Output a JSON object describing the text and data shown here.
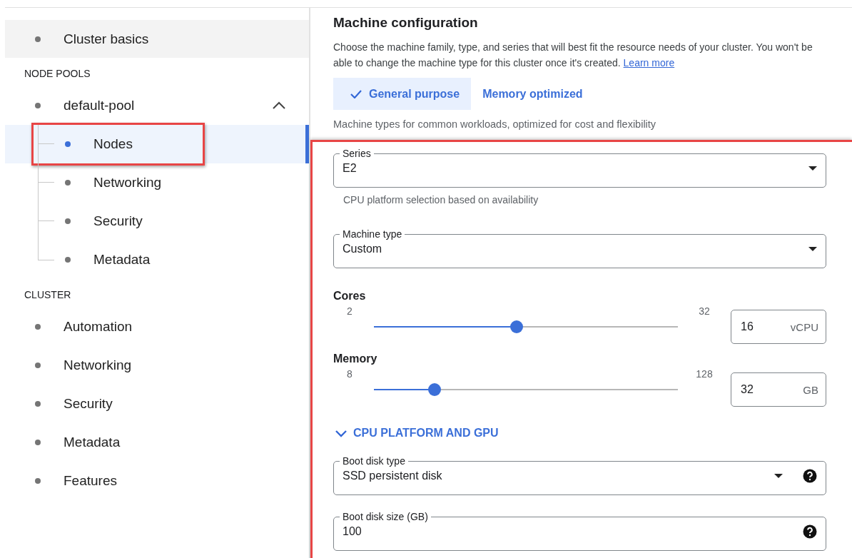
{
  "sidebar": {
    "top_item": {
      "label": "Cluster basics",
      "hovered": true,
      "selected": false
    },
    "groups": [
      {
        "heading": "NODE POOLS",
        "items": [
          {
            "label": "default-pool",
            "selected": false,
            "expanded": true,
            "children": [
              {
                "label": "Nodes",
                "selected": true,
                "annotated": true
              },
              {
                "label": "Networking",
                "selected": false,
                "annotated": false
              },
              {
                "label": "Security",
                "selected": false,
                "annotated": false
              },
              {
                "label": "Metadata",
                "selected": false,
                "annotated": false
              }
            ]
          }
        ]
      },
      {
        "heading": "CLUSTER",
        "items": [
          {
            "label": "Automation",
            "selected": false
          },
          {
            "label": "Networking",
            "selected": false
          },
          {
            "label": "Security",
            "selected": false
          },
          {
            "label": "Metadata",
            "selected": false
          },
          {
            "label": "Features",
            "selected": false
          }
        ]
      }
    ]
  },
  "main": {
    "title": "Machine configuration",
    "description": "Choose the machine family, type, and series that will best fit the resource needs of your cluster. You won't be able to change the machine type for this cluster once it's created.",
    "link": "Learn more",
    "tabs": [
      {
        "label": "General purpose",
        "selected": true
      },
      {
        "label": "Memory optimized",
        "selected": false
      }
    ],
    "tab_hint": "Machine types for common workloads, optimized for cost and flexibility",
    "panel": {
      "annotated": true,
      "fields": [
        {
          "kind": "select",
          "label": "Series",
          "value": "E2",
          "helper": "CPU platform selection based on availability",
          "help": false
        },
        {
          "kind": "select",
          "label": "Machine type",
          "value": "Custom",
          "help": false
        },
        {
          "kind": "slider",
          "label": "Cores",
          "min": "2",
          "max": "32",
          "level": 0.47,
          "value": "16",
          "unit": "vCPU"
        },
        {
          "kind": "slider",
          "label": "Memory",
          "min": "8",
          "max": "128",
          "level": 0.2,
          "value": "32",
          "unit": "GB"
        },
        {
          "kind": "expander",
          "label": "CPU PLATFORM AND GPU",
          "expanded": false
        },
        {
          "kind": "select",
          "label": "Boot disk type",
          "value": "SSD persistent disk",
          "help": true
        },
        {
          "kind": "input",
          "label": "Boot disk size (GB)",
          "value": "100",
          "help": true
        }
      ]
    }
  }
}
